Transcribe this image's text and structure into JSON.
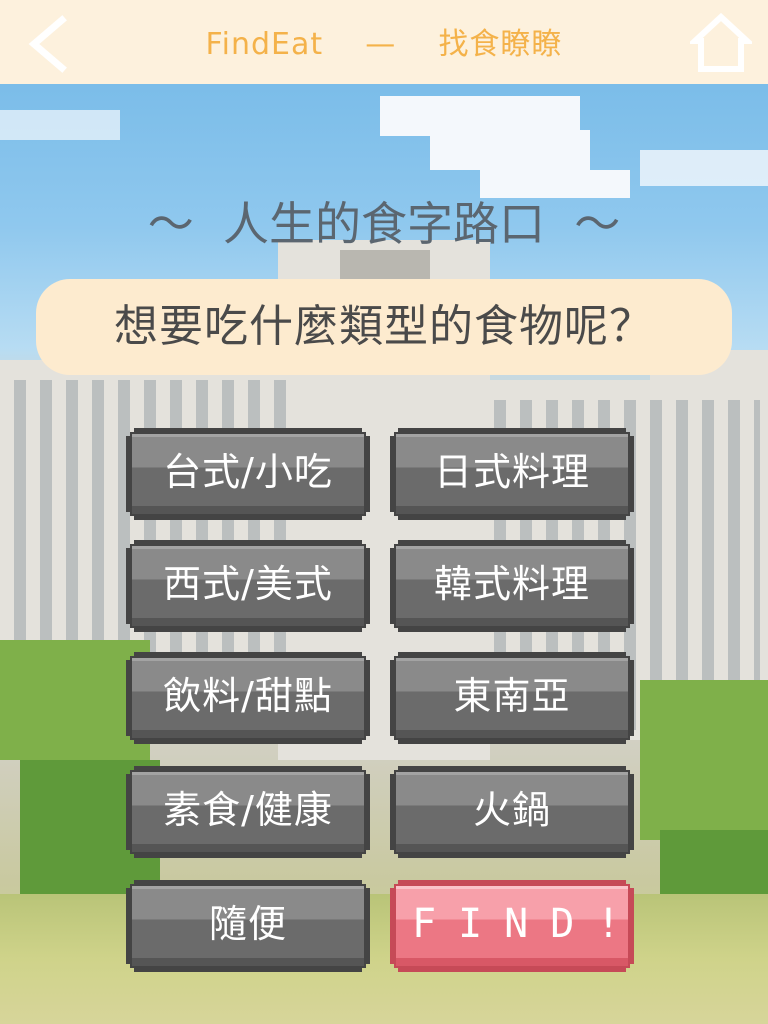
{
  "header": {
    "app_name": "FindEat",
    "separator": "—",
    "app_subtitle": "找食瞭瞭",
    "back_icon": "chevron-left-icon",
    "home_icon": "home-icon",
    "accent_color": "#f4b24a"
  },
  "main": {
    "subtitle": "～  人生的食字路口  ～",
    "question": "想要吃什麼類型的食物呢？"
  },
  "categories": [
    {
      "label": "台式/小吃"
    },
    {
      "label": "日式料理"
    },
    {
      "label": "西式/美式"
    },
    {
      "label": "韓式料理"
    },
    {
      "label": "飲料/甜點"
    },
    {
      "label": "東南亞"
    },
    {
      "label": "素食/健康"
    },
    {
      "label": "火鍋"
    },
    {
      "label": "隨便"
    }
  ],
  "find_button": {
    "label": "FIND!",
    "color": "#ec7784"
  }
}
